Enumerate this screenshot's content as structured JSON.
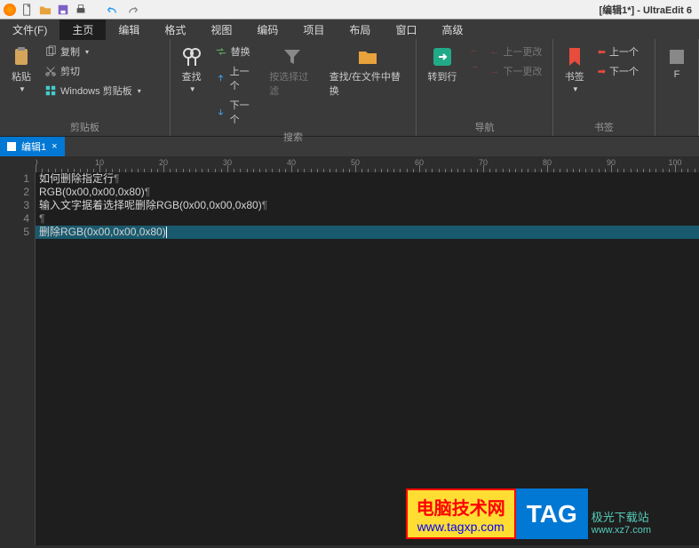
{
  "title": "[编辑1*] - UltraEdit 6",
  "menus": {
    "file": "文件(F)",
    "home": "主页",
    "edit": "编辑",
    "format": "格式",
    "view": "视图",
    "encoding": "编码",
    "project": "项目",
    "layout": "布局",
    "window": "窗口",
    "advanced": "高级"
  },
  "ribbon": {
    "clipboard": {
      "paste": "粘贴",
      "copy": "复制",
      "cut": "剪切",
      "winclip": "Windows 剪贴板",
      "label": "剪贴板"
    },
    "search": {
      "find": "查找",
      "replace": "替换",
      "prev": "上一个",
      "next": "下一个",
      "filter": "按选择过滤",
      "findreplacefiles": "查找/在文件中替换",
      "label": "搜索"
    },
    "nav": {
      "goto": "转到行",
      "prevchange": "上一更改",
      "nextchange": "下一更改",
      "label": "导航"
    },
    "bookmark": {
      "bookmark": "书签",
      "prev": "上一个",
      "next": "下一个",
      "label": "书签"
    }
  },
  "filetab": {
    "name": "编辑1",
    "close": "×"
  },
  "ruler_marks": [
    "0",
    "10",
    "20",
    "30",
    "40",
    "50",
    "60",
    "70",
    "80",
    "90",
    "100"
  ],
  "lines": [
    {
      "n": "1",
      "text": "如何删除指定行",
      "pil": "¶"
    },
    {
      "n": "2",
      "text": "RGB(0x00,0x00,0x80)",
      "pil": "¶"
    },
    {
      "n": "3",
      "text": "输入文字据着选择呢删除RGB(0x00,0x00,0x80)",
      "pil": "¶"
    },
    {
      "n": "4",
      "text": "",
      "pil": "¶"
    },
    {
      "n": "5",
      "text": "删除RGB(0x00,0x00,0x80)",
      "pil": "",
      "hl": true
    }
  ],
  "watermark": {
    "cn": "电脑技术网",
    "url": "www.tagxp.com",
    "tag": "TAG",
    "brand": "极光下载站",
    "brandurl": "www.xz7.com"
  }
}
